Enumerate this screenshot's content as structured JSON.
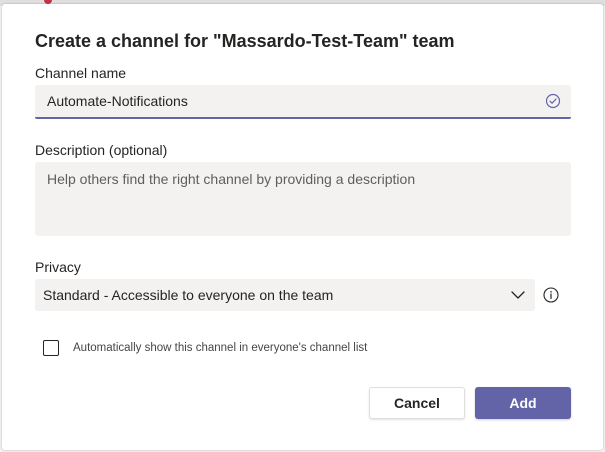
{
  "dialog": {
    "title": "Create a channel for \"Massardo-Test-Team\" team"
  },
  "channel_name": {
    "label": "Channel name",
    "value": "Automate-Notifications",
    "status_icon": "check-circle-icon"
  },
  "description": {
    "label": "Description (optional)",
    "placeholder": "Help others find the right channel by providing a description"
  },
  "privacy": {
    "label": "Privacy",
    "selected": "Standard - Accessible to everyone on the team",
    "dropdown_icon": "chevron-down-icon",
    "info_icon": "info-icon"
  },
  "auto_show": {
    "label": "Automatically show this channel in everyone's channel list",
    "checked": false
  },
  "buttons": {
    "cancel": "Cancel",
    "add": "Add"
  },
  "colors": {
    "accent": "#6264a7",
    "field_bg": "#f3f2f1",
    "text": "#252423"
  }
}
